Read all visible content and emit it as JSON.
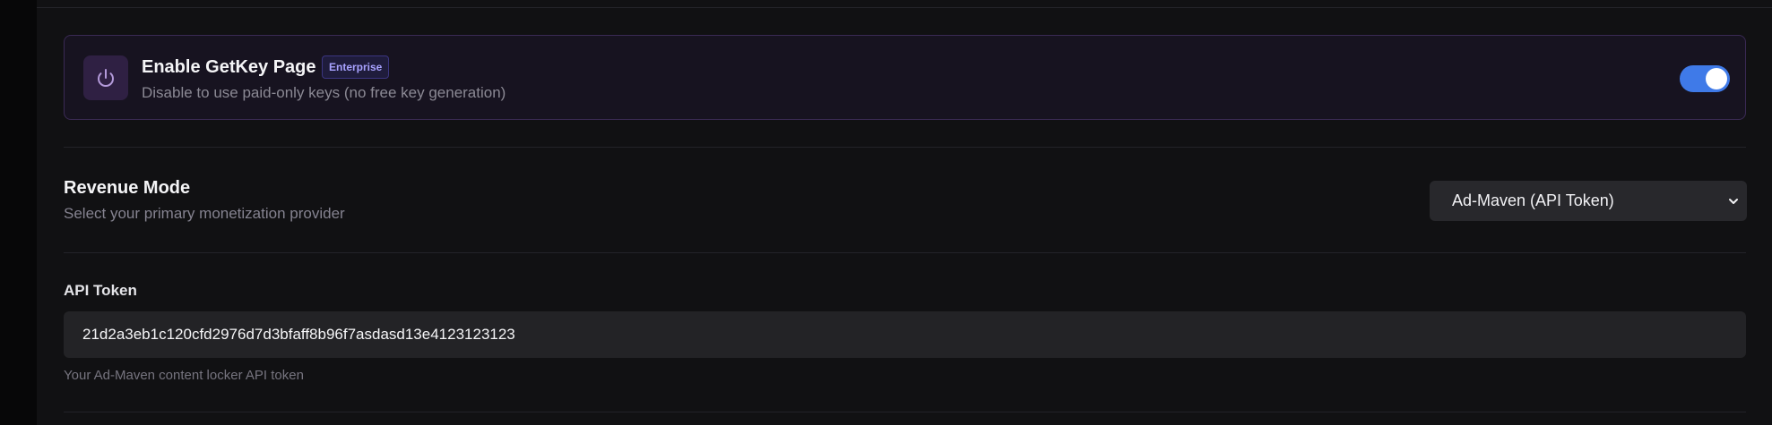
{
  "getkey": {
    "title": "Enable GetKey Page",
    "badge": "Enterprise",
    "description": "Disable to use paid-only keys (no free key generation)",
    "enabled": true,
    "icon": "power-icon"
  },
  "revenue": {
    "title": "Revenue Mode",
    "description": "Select your primary monetization provider",
    "selected": "Ad-Maven (API Token)"
  },
  "api_token": {
    "label": "API Token",
    "value": "21d2a3eb1c120cfd2976d7d3bfaff8b96f7asdasd13e4123123123",
    "hint": "Your Ad-Maven content locker API token"
  },
  "colors": {
    "accent": "#3f7ae8",
    "badge_text": "#a8a2ff",
    "card_border": "#3a2a54"
  }
}
